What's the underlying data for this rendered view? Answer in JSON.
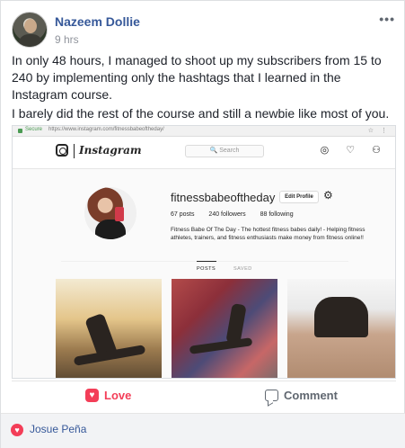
{
  "post": {
    "author": "Nazeem Dollie",
    "time": "9 hrs",
    "more": "•••",
    "text_lines": [
      "In only 48 hours, I managed to shoot up my subscribers from 15 to 240 by implementing only the hashtags that I learned in the Instagram course.",
      "I barely did the rest of the course and still a newbie like most of you."
    ]
  },
  "screenshot": {
    "browser": {
      "secure": "Secure",
      "url": "https://www.instagram.com/fitnessbabeoftheday/",
      "icons": "☆ ⋮"
    },
    "instagram": {
      "logo": "Instagram",
      "search_placeholder": "🔍 Search",
      "nav_icons": "◎ ♡ ⚇"
    },
    "profile": {
      "username": "fitnessbabeoftheday",
      "edit_button": "Edit Profile",
      "settings_icon": "⚙",
      "stats": {
        "posts": "67 posts",
        "followers": "240 followers",
        "following": "88 following"
      },
      "bio": "Fitness Babe Of The Day - The hottest fitness babes daily! - Helping fitness athletes, trainers, and fitness enthusiasts make money from fitness online!!",
      "tabs": [
        "POSTS",
        "SAVED"
      ]
    }
  },
  "actions": {
    "love_label": "Love",
    "love_icon": "♥",
    "comment_label": "Comment"
  },
  "reactions": {
    "icon": "♥",
    "name": "Josue Peña"
  }
}
